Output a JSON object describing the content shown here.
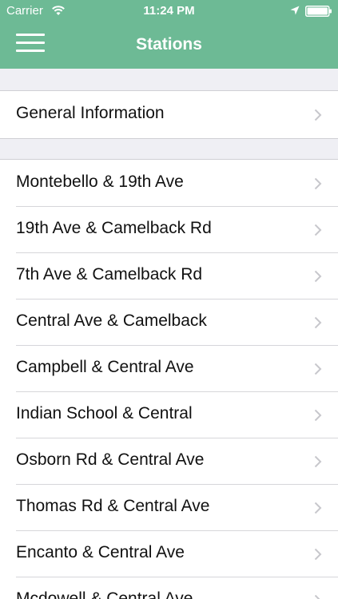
{
  "status_bar": {
    "carrier": "Carrier",
    "time": "11:24 PM"
  },
  "nav": {
    "title": "Stations"
  },
  "general": {
    "label": "General Information"
  },
  "stations": [
    {
      "label": "Montebello & 19th Ave"
    },
    {
      "label": "19th Ave & Camelback Rd"
    },
    {
      "label": "7th Ave & Camelback Rd"
    },
    {
      "label": "Central Ave & Camelback"
    },
    {
      "label": "Campbell & Central Ave"
    },
    {
      "label": "Indian School & Central"
    },
    {
      "label": "Osborn Rd & Central Ave"
    },
    {
      "label": "Thomas Rd & Central Ave"
    },
    {
      "label": "Encanto & Central Ave"
    },
    {
      "label": "Mcdowell & Central Ave"
    }
  ],
  "colors": {
    "header": "#6dba95",
    "section_gap": "#efeff4"
  },
  "icons": {
    "menu": "hamburger-menu-icon",
    "chevron": "chevron-right-icon",
    "wifi": "wifi-icon",
    "location": "location-arrow-icon",
    "battery": "battery-icon"
  }
}
